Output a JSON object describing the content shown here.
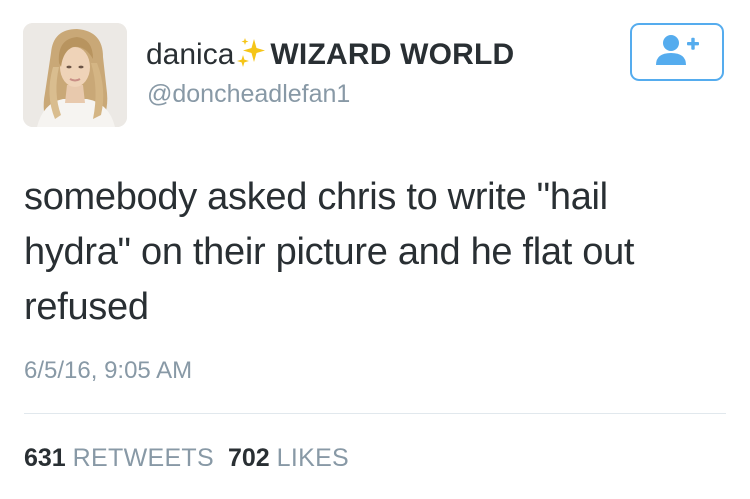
{
  "tweet": {
    "author": {
      "display_name": "danica",
      "display_name_suffix": "WIZARD WORLD",
      "display_name_emoji": "sparkles-icon",
      "handle": "@doncheadlefan1",
      "avatar": "profile-photo"
    },
    "follow_button_icon": "add-user-icon",
    "text": "somebody asked chris to write \"hail hydra\" on their picture and he flat out refused",
    "timestamp": "6/5/16, 9:05 AM",
    "stats": {
      "retweets_count": "631",
      "retweets_label": "RETWEETS",
      "likes_count": "702",
      "likes_label": "LIKES"
    }
  },
  "colors": {
    "text_primary": "#292f33",
    "text_secondary": "#8899a6",
    "accent": "#55acee",
    "divider": "#e1e8ed",
    "sparkle": "#f5c518"
  }
}
